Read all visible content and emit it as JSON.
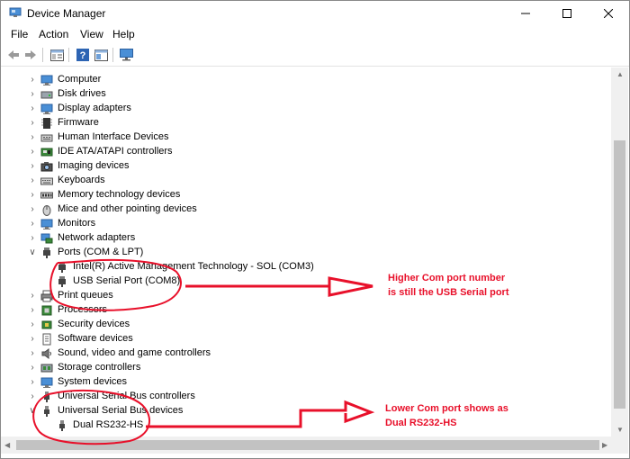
{
  "window": {
    "title": "Device Manager"
  },
  "menu": [
    "File",
    "Action",
    "View",
    "Help"
  ],
  "toolbar": [
    "back-icon",
    "forward-icon",
    "properties-icon",
    "help-icon",
    "console-tree-icon",
    "monitor-icon"
  ],
  "tree": [
    {
      "label": "Computer",
      "icon": "computer-icon",
      "expanded": false
    },
    {
      "label": "Disk drives",
      "icon": "disk-drive-icon",
      "expanded": false
    },
    {
      "label": "Display adapters",
      "icon": "display-adapter-icon",
      "expanded": false
    },
    {
      "label": "Firmware",
      "icon": "firmware-icon",
      "expanded": false
    },
    {
      "label": "Human Interface Devices",
      "icon": "hid-icon",
      "expanded": false
    },
    {
      "label": "IDE ATA/ATAPI controllers",
      "icon": "ide-controller-icon",
      "expanded": false
    },
    {
      "label": "Imaging devices",
      "icon": "camera-icon",
      "expanded": false
    },
    {
      "label": "Keyboards",
      "icon": "keyboard-icon",
      "expanded": false
    },
    {
      "label": "Memory technology devices",
      "icon": "memory-icon",
      "expanded": false
    },
    {
      "label": "Mice and other pointing devices",
      "icon": "mouse-icon",
      "expanded": false
    },
    {
      "label": "Monitors",
      "icon": "monitor-icon",
      "expanded": false
    },
    {
      "label": "Network adapters",
      "icon": "network-icon",
      "expanded": false
    },
    {
      "label": "Ports (COM & LPT)",
      "icon": "port-icon",
      "expanded": true,
      "children": [
        {
          "label": "Intel(R) Active Management Technology - SOL (COM3)",
          "icon": "port-icon"
        },
        {
          "label": "USB Serial Port (COM8)",
          "icon": "port-icon"
        }
      ]
    },
    {
      "label": "Print queues",
      "icon": "printer-icon",
      "expanded": false
    },
    {
      "label": "Processors",
      "icon": "processor-icon",
      "expanded": false
    },
    {
      "label": "Security devices",
      "icon": "security-icon",
      "expanded": false
    },
    {
      "label": "Software devices",
      "icon": "software-icon",
      "expanded": false
    },
    {
      "label": "Sound, video and game controllers",
      "icon": "sound-icon",
      "expanded": false
    },
    {
      "label": "Storage controllers",
      "icon": "storage-icon",
      "expanded": false
    },
    {
      "label": "System devices",
      "icon": "system-icon",
      "expanded": false
    },
    {
      "label": "Universal Serial Bus controllers",
      "icon": "usb-icon",
      "expanded": false
    },
    {
      "label": "Universal Serial Bus devices",
      "icon": "usb-icon",
      "expanded": true,
      "children": [
        {
          "label": "Dual RS232-HS",
          "icon": "usb-icon"
        }
      ]
    }
  ],
  "annotations": {
    "note1": [
      "Higher Com port number",
      "is still the USB Serial port"
    ],
    "note2": [
      "Lower Com port shows as",
      "Dual RS232-HS"
    ],
    "color": "#e8102a"
  }
}
